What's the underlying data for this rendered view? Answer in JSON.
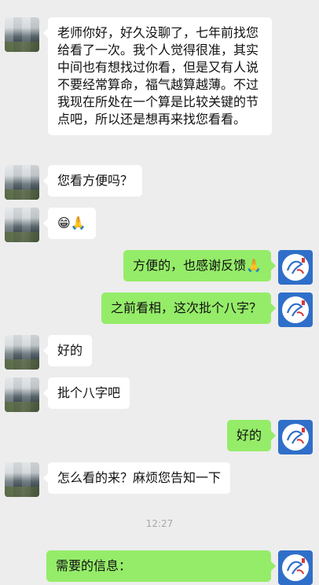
{
  "messages": [
    {
      "side": "left",
      "text": "老师你好，好久没聊了，七年前找您给看了一次。我个人觉得很准，其实中间也有想找过你看，但是又有人说不要经常算命，福气越算越薄。不过我现在所处在一个算是比较关键的节点吧，所以还是想再来找您看看。"
    },
    {
      "side": "left",
      "text": "您看方便吗？"
    },
    {
      "side": "left",
      "text": "😁🙏"
    },
    {
      "side": "right",
      "text": "方便的，也感谢反馈🙏"
    },
    {
      "side": "right",
      "text": "之前看相，这次批个八字？"
    },
    {
      "side": "left",
      "text": "好的"
    },
    {
      "side": "left",
      "text": "批个八字吧"
    },
    {
      "side": "right",
      "text": "好的"
    },
    {
      "side": "left",
      "text": "怎么看的来？麻烦您告知一下"
    },
    {
      "side": "right",
      "text": "需要的信息："
    }
  ],
  "timestamp": "12:27",
  "icons": {
    "contact_avatar": "blurred-avatar",
    "self_avatar": "calligraphy-logo-avatar"
  },
  "colors": {
    "background": "#ededed",
    "bubble_self": "#95ec69",
    "bubble_other": "#ffffff",
    "self_avatar": "#2f6fc9"
  }
}
